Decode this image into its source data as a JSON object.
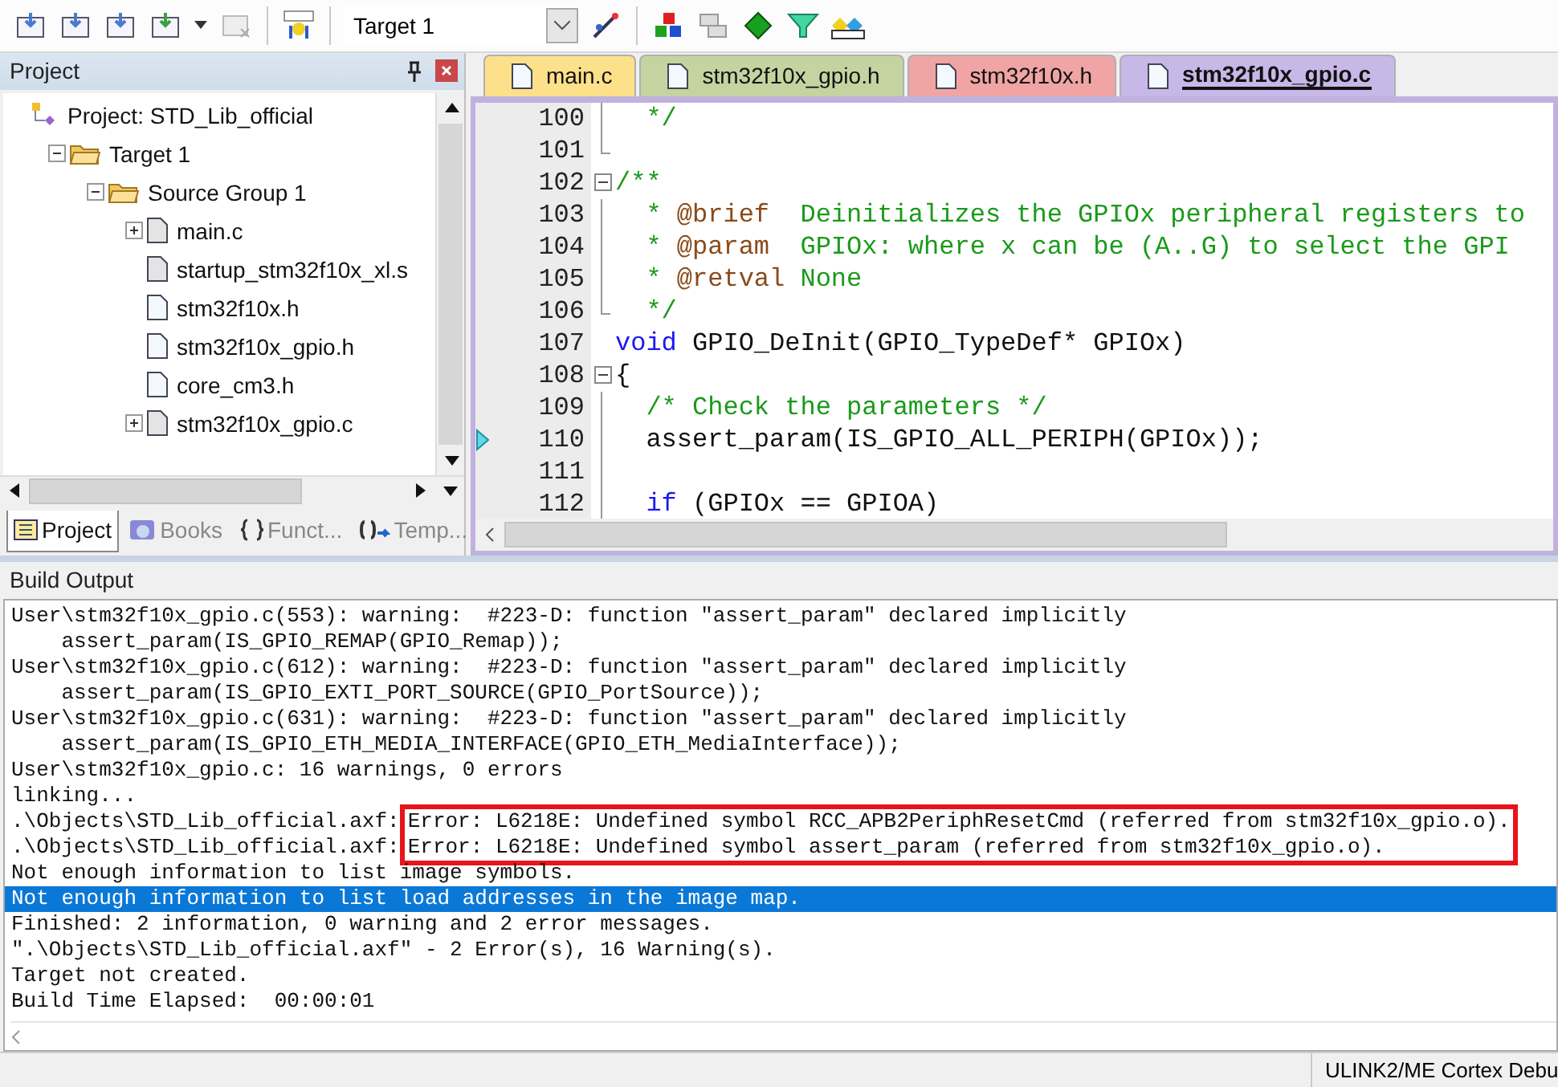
{
  "toolbar": {
    "target": "Target 1"
  },
  "project_panel": {
    "title": "Project",
    "tree": [
      {
        "label": "Project: STD_Lib_official",
        "kind": "project",
        "children": [
          {
            "label": "Target 1",
            "kind": "target",
            "expanded": true,
            "children": [
              {
                "label": "Source Group 1",
                "kind": "group",
                "expanded": true,
                "children": [
                  {
                    "label": "main.c",
                    "kind": "source",
                    "expanded": false
                  },
                  {
                    "label": "startup_stm32f10x_xl.s",
                    "kind": "source"
                  },
                  {
                    "label": "stm32f10x.h",
                    "kind": "header"
                  },
                  {
                    "label": "stm32f10x_gpio.h",
                    "kind": "header"
                  },
                  {
                    "label": "core_cm3.h",
                    "kind": "header"
                  },
                  {
                    "label": "stm32f10x_gpio.c",
                    "kind": "source",
                    "expanded": false
                  }
                ]
              }
            ]
          }
        ]
      }
    ],
    "tabs": [
      {
        "label": "Project",
        "kind": "project",
        "selected": true
      },
      {
        "label": "Books",
        "kind": "books",
        "selected": false
      },
      {
        "label": "Funct...",
        "kind": "functions",
        "selected": false
      },
      {
        "label": "Temp...",
        "kind": "templates",
        "selected": false
      }
    ]
  },
  "editor": {
    "tabs": [
      {
        "label": "main.c",
        "color": "#fde08a",
        "selected": false
      },
      {
        "label": "stm32f10x_gpio.h",
        "color": "#c4d4a0",
        "selected": false
      },
      {
        "label": "stm32f10x.h",
        "color": "#f0a4a4",
        "selected": false
      },
      {
        "label": "stm32f10x_gpio.c",
        "color": "#c8b8e8",
        "selected": true
      }
    ],
    "lines": [
      {
        "number": "100",
        "kind": "line",
        "segments": [
          {
            "kind": "comment",
            "text": "  */"
          }
        ]
      },
      {
        "number": "101",
        "kind": "end"
      },
      {
        "number": "102",
        "kind": "open",
        "segments": [
          {
            "kind": "comment",
            "text": "/**"
          }
        ]
      },
      {
        "number": "103",
        "kind": "line",
        "segments": [
          {
            "kind": "comment",
            "text": "  * "
          },
          {
            "kind": "tag",
            "text": "@brief"
          },
          {
            "kind": "comment",
            "text": "  Deinitializes the GPIOx peripheral registers to"
          }
        ]
      },
      {
        "number": "104",
        "kind": "line",
        "segments": [
          {
            "kind": "comment",
            "text": "  * "
          },
          {
            "kind": "tag",
            "text": "@param"
          },
          {
            "kind": "comment",
            "text": "  GPIOx: where x can be (A..G) to select the GPI"
          }
        ]
      },
      {
        "number": "105",
        "kind": "line",
        "segments": [
          {
            "kind": "comment",
            "text": "  * "
          },
          {
            "kind": "tag",
            "text": "@retval"
          },
          {
            "kind": "comment",
            "text": " None"
          }
        ]
      },
      {
        "number": "106",
        "kind": "end",
        "segments": [
          {
            "kind": "comment",
            "text": "  */"
          }
        ]
      },
      {
        "number": "107",
        "kind": "plain",
        "segments": [
          {
            "kind": "keyword",
            "text": "void"
          },
          {
            "kind": "plain",
            "text": " GPIO_DeInit(GPIO_TypeDef* GPIOx)"
          }
        ]
      },
      {
        "number": "108",
        "kind": "open",
        "segments": [
          {
            "kind": "plain",
            "text": "{"
          }
        ]
      },
      {
        "number": "109",
        "kind": "line",
        "segments": [
          {
            "kind": "comment",
            "text": "  /* Check the parameters */"
          }
        ]
      },
      {
        "number": "110",
        "kind": "line",
        "marker": true,
        "segments": [
          {
            "kind": "plain",
            "text": "  assert_param(IS_GPIO_ALL_PERIPH(GPIOx));"
          }
        ]
      },
      {
        "number": "111",
        "kind": "line"
      },
      {
        "number": "112",
        "kind": "line",
        "segments": [
          {
            "kind": "keyword",
            "text": "  if"
          },
          {
            "kind": "plain",
            "text": " (GPIOx == GPIOA)"
          }
        ]
      }
    ]
  },
  "build_output": {
    "title": "Build Output",
    "lines": [
      {
        "kind": "text",
        "text": "User\\stm32f10x_gpio.c(553): warning:  #223-D: function \"assert_param\" declared implicitly",
        "selected": false
      },
      {
        "kind": "text",
        "text": "    assert_param(IS_GPIO_REMAP(GPIO_Remap));",
        "selected": false
      },
      {
        "kind": "text",
        "text": "User\\stm32f10x_gpio.c(612): warning:  #223-D: function \"assert_param\" declared implicitly",
        "selected": false
      },
      {
        "kind": "text",
        "text": "    assert_param(IS_GPIO_EXTI_PORT_SOURCE(GPIO_PortSource));",
        "selected": false
      },
      {
        "kind": "text",
        "text": "User\\stm32f10x_gpio.c(631): warning:  #223-D: function \"assert_param\" declared implicitly",
        "selected": false
      },
      {
        "kind": "text",
        "text": "    assert_param(IS_GPIO_ETH_MEDIA_INTERFACE(GPIO_ETH_MediaInterface));",
        "selected": false
      },
      {
        "kind": "text",
        "text": "User\\stm32f10x_gpio.c: 16 warnings, 0 errors",
        "selected": false
      },
      {
        "kind": "text",
        "text": "linking...",
        "selected": false
      },
      {
        "kind": "errors",
        "rows": [
          {
            "source": ".\\Objects\\STD_Lib_official.axf:",
            "message": "Error: L6218E: Undefined symbol RCC_APB2PeriphResetCmd (referred from stm32f10x_gpio.o).",
            "selected": false
          },
          {
            "source": ".\\Objects\\STD_Lib_official.axf:",
            "message": "Error: L6218E: Undefined symbol assert_param (referred from stm32f10x_gpio.o).",
            "selected": false
          }
        ]
      },
      {
        "kind": "text",
        "text": "Not enough information to list image symbols.",
        "selected": false
      },
      {
        "kind": "text",
        "text": "Not enough information to list load addresses in the image map.",
        "selected": true
      },
      {
        "kind": "text",
        "text": "Finished: 2 information, 0 warning and 2 error messages.",
        "selected": false
      },
      {
        "kind": "text",
        "text": "\".\\Objects\\STD_Lib_official.axf\" - 2 Error(s), 16 Warning(s).",
        "selected": false
      },
      {
        "kind": "text",
        "text": "Target not created.",
        "selected": false
      },
      {
        "kind": "text",
        "text": "Build Time Elapsed:  00:00:01",
        "selected": false
      }
    ]
  },
  "status_bar": {
    "debugger": "ULINK2/ME Cortex Debu"
  }
}
